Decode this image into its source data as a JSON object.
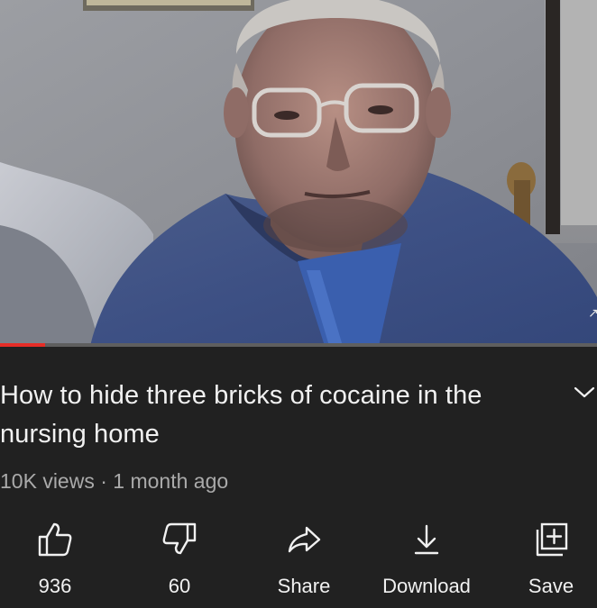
{
  "video": {
    "progress_fraction": 0.075
  },
  "title": "How to hide three bricks of cocaine in the nursing home",
  "meta": {
    "views": "10K views",
    "separator": "·",
    "age": "1 month ago"
  },
  "actions": [
    {
      "label": "936",
      "icon": "thumbs-up-icon"
    },
    {
      "label": "60",
      "icon": "thumbs-down-icon"
    },
    {
      "label": "Share",
      "icon": "share-icon"
    },
    {
      "label": "Download",
      "icon": "download-icon"
    },
    {
      "label": "Save",
      "icon": "save-to-playlist-icon"
    }
  ],
  "colors": {
    "background": "#212121",
    "text": "#f1f1f1",
    "secondary_text": "#aaaaaa",
    "progress": "#e52d27"
  }
}
